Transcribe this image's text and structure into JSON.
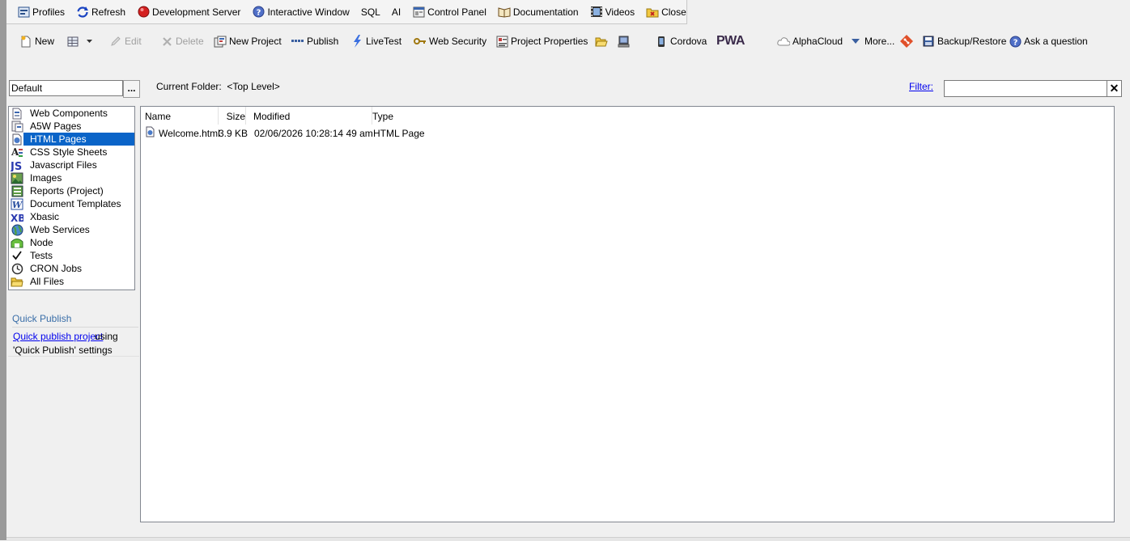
{
  "toolbar": {
    "items": [
      {
        "label": "Profiles",
        "icon": "profiles-icon"
      },
      {
        "label": "Refresh",
        "icon": "refresh-icon"
      },
      {
        "label": "Development Server",
        "icon": "server-icon"
      },
      {
        "label": "Interactive Window",
        "icon": "help-icon"
      },
      {
        "label": "SQL"
      },
      {
        "label": "AI"
      },
      {
        "label": "Control Panel",
        "icon": "control-panel-icon"
      },
      {
        "label": "Documentation",
        "icon": "book-icon"
      },
      {
        "label": "Videos",
        "icon": "film-icon"
      },
      {
        "label": "Close",
        "icon": "close-folder-icon"
      }
    ]
  },
  "actions": {
    "new": "New",
    "edit": "Edit",
    "delete": "Delete",
    "new_project": "New Project",
    "publish": "Publish",
    "livetest": "LiveTest",
    "web_security": "Web Security",
    "project_properties": "Project Properties",
    "cordova": "Cordova",
    "pwa": "PWA",
    "alphacloud": "AlphaCloud",
    "more": "More...",
    "backup_restore": "Backup/Restore",
    "ask_question": "Ask a question"
  },
  "profile": {
    "value": "Default",
    "browse_label": "..."
  },
  "folder": {
    "label": "Current Folder:",
    "value": "<Top Level>"
  },
  "filter": {
    "label": "Filter:",
    "value": "",
    "clear_label": "✕"
  },
  "categories": [
    {
      "label": "Web Components",
      "icon": "web-components-icon"
    },
    {
      "label": "A5W Pages",
      "icon": "a5w-pages-icon"
    },
    {
      "label": "HTML Pages",
      "icon": "html-pages-icon",
      "selected": true
    },
    {
      "label": "CSS Style Sheets",
      "icon": "css-icon"
    },
    {
      "label": "Javascript Files",
      "icon": "js-icon"
    },
    {
      "label": "Images",
      "icon": "images-icon"
    },
    {
      "label": "Reports (Project)",
      "icon": "reports-icon"
    },
    {
      "label": "Document Templates",
      "icon": "word-icon"
    },
    {
      "label": "Xbasic",
      "icon": "xbasic-icon"
    },
    {
      "label": "Web Services",
      "icon": "globe-icon"
    },
    {
      "label": "Node",
      "icon": "node-icon"
    },
    {
      "label": "Tests",
      "icon": "check-icon"
    },
    {
      "label": "CRON Jobs",
      "icon": "clock-icon"
    },
    {
      "label": "All Files",
      "icon": "folder-icon"
    }
  ],
  "quick_publish": {
    "title": "Quick Publish",
    "link": "Quick publish project",
    "text1": "using",
    "text2": "'Quick Publish' settings"
  },
  "file_list": {
    "columns": [
      "Name",
      "Size",
      "Modified",
      "Type"
    ],
    "rows": [
      {
        "name": "Welcome.html",
        "size": "3.9 KB",
        "modified": "02/06/2026 10:28:14 49 am",
        "type": "HTML Page"
      }
    ]
  },
  "colors": {
    "selection": "#0a64c8",
    "link": "#0000ee",
    "quick_publish_title": "#3a6ea8"
  }
}
